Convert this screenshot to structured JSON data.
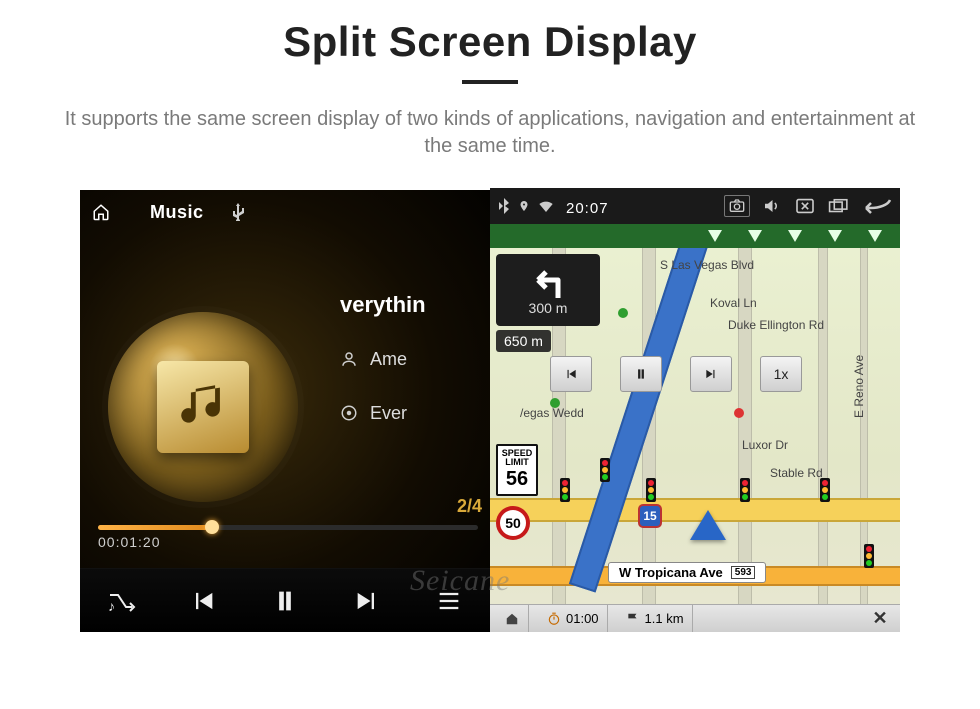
{
  "page": {
    "title": "Split Screen Display",
    "subtitle": "It supports the same screen display of two kinds of applications, navigation and entertainment at the same time."
  },
  "music": {
    "topbar_title": "Music",
    "source": "USB",
    "tracks": {
      "current": "verythin",
      "next1_artist": "Ame",
      "next2_title": "Ever"
    },
    "track_index": "2/4",
    "elapsed": "00:01:20",
    "progress_pct": 30
  },
  "sysbar": {
    "time": "20:07"
  },
  "nav": {
    "greenbar_arrows": 5,
    "turn_distance": "300 m",
    "approach_distance": "650 m",
    "sim_speed": "1x",
    "speed_limit_label_top": "SPEED",
    "speed_limit_label_mid": "LIMIT",
    "speed_limit_value": "56",
    "current_speed": "50",
    "highway_shield": "15",
    "streets": {
      "s_las_vegas": "S Las Vegas Blvd",
      "koval": "Koval Ln",
      "duke": "Duke Ellington Rd",
      "luxor": "Luxor Dr",
      "stable": "Stable Rd",
      "reno": "E Reno Ave",
      "tropicana": "W Tropicana Ave",
      "tropicana_num": "593",
      "vegas_wedge": "/egas Wedd"
    },
    "footer": {
      "eta": "01:00",
      "remaining": "1.1 km"
    }
  },
  "watermark": "Seicane"
}
